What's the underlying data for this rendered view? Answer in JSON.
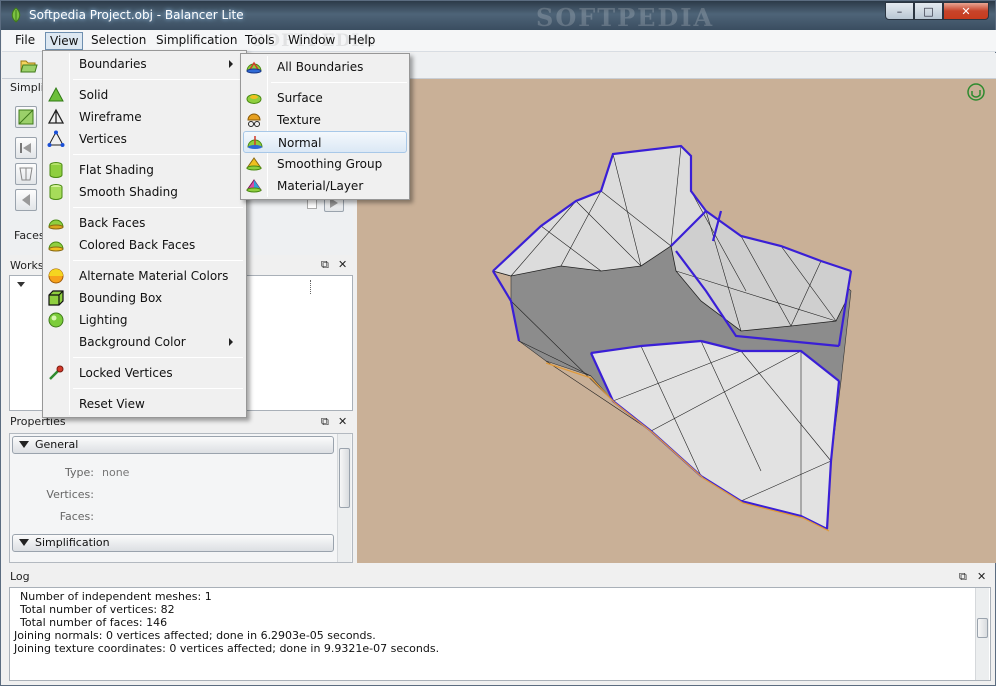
{
  "window": {
    "title": "Softpedia Project.obj - Balancer Lite",
    "watermark": "SOFTPEDIA",
    "buttons": {
      "minimize": "–",
      "maximize": "□",
      "close": "✕"
    }
  },
  "menubar": {
    "file": "File",
    "view": "View",
    "selection": "Selection",
    "simplification": "Simplification",
    "tools": "Tools",
    "window": "Window",
    "help": "Help",
    "menubar_watermark": "SOFTPEDIA"
  },
  "left_panel": {
    "simplification_title": "Simplifi",
    "faces_label": "Faces",
    "workspace_title": "Worksp",
    "properties_title": "Properties",
    "general_section": "General",
    "simplification_section": "Simplification",
    "props": [
      {
        "label": "Type:",
        "value": "none"
      },
      {
        "label": "Vertices:",
        "value": ""
      },
      {
        "label": "Faces:",
        "value": ""
      }
    ],
    "dock_float": "⧉",
    "dock_close": "✕"
  },
  "view_menu": {
    "items": [
      {
        "label": "Boundaries",
        "icon": "none",
        "submenu": true
      },
      {
        "label": "Solid",
        "icon": "solid-icon"
      },
      {
        "label": "Wireframe",
        "icon": "wireframe-icon"
      },
      {
        "label": "Vertices",
        "icon": "vertices-icon"
      },
      {
        "label": "Flat Shading",
        "icon": "flat-shading-icon"
      },
      {
        "label": "Smooth Shading",
        "icon": "smooth-shading-icon"
      },
      {
        "label": "Back Faces",
        "icon": "back-faces-icon"
      },
      {
        "label": "Colored Back Faces",
        "icon": "colored-back-faces-icon"
      },
      {
        "label": "Alternate Material Colors",
        "icon": "material-colors-icon"
      },
      {
        "label": "Bounding Box",
        "icon": "bounding-box-icon"
      },
      {
        "label": "Lighting",
        "icon": "lighting-icon"
      },
      {
        "label": "Background Color",
        "icon": "none",
        "submenu": true
      },
      {
        "label": "Locked Vertices",
        "icon": "locked-vertices-icon"
      },
      {
        "label": "Reset View",
        "icon": "none"
      }
    ]
  },
  "boundaries_menu": {
    "items": [
      {
        "label": "All Boundaries",
        "icon": "all-boundaries-icon"
      },
      {
        "label": "Surface",
        "icon": "surface-icon"
      },
      {
        "label": "Texture",
        "icon": "texture-icon"
      },
      {
        "label": "Normal",
        "icon": "normal-icon",
        "highlighted": true
      },
      {
        "label": "Smoothing Group",
        "icon": "smoothing-group-icon"
      },
      {
        "label": "Material/Layer",
        "icon": "material-layer-icon"
      }
    ]
  },
  "log": {
    "title": "Log",
    "lines": [
      "Number of independent meshes: 1",
      "Total number of vertices: 82",
      "Total number of faces: 146",
      "Joining normals: 0 vertices affected; done in 6.2903e-05 seconds.",
      "Joining texture coordinates: 0 vertices affected; done in 9.9321e-07 seconds."
    ]
  },
  "colors": {
    "viewport_bg": "#c9b097",
    "mesh_face": "#d9d9d9",
    "mesh_edge_boundary": "#3a1fd6",
    "menu_highlight": "#dbe8f5"
  }
}
